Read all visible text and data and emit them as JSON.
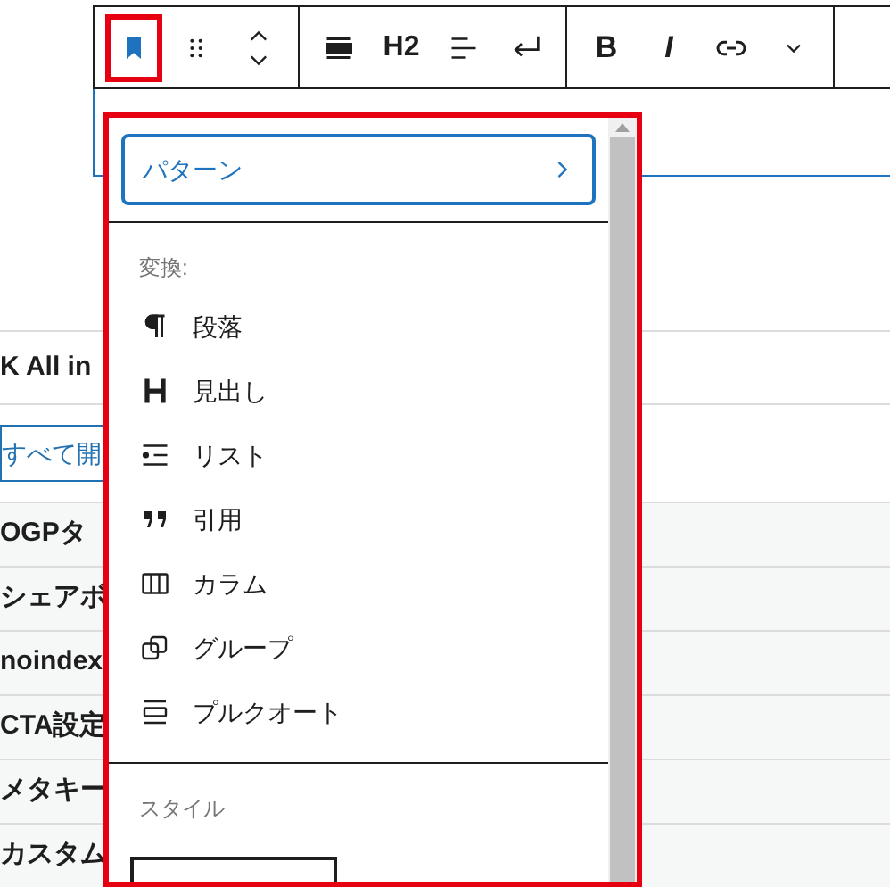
{
  "toolbar": {
    "groups": [
      [
        {
          "kind": "bookmark",
          "highlighted": true
        },
        {
          "kind": "drag"
        },
        {
          "kind": "move"
        }
      ],
      [
        {
          "kind": "align-wide"
        },
        {
          "kind": "text",
          "label": "H2"
        },
        {
          "kind": "align-left"
        },
        {
          "kind": "return"
        }
      ],
      [
        {
          "kind": "bold",
          "label": "B"
        },
        {
          "kind": "italic",
          "label": "I"
        },
        {
          "kind": "link"
        },
        {
          "kind": "more"
        }
      ]
    ]
  },
  "sidebar": {
    "rows": [
      {
        "kind": "heading",
        "text": "K All in"
      },
      {
        "kind": "link",
        "text": "すべて開"
      },
      {
        "kind": "row",
        "text": "OGPタ"
      },
      {
        "kind": "row",
        "text": "シェアボ"
      },
      {
        "kind": "row",
        "text": "noindex"
      },
      {
        "kind": "row",
        "text": "CTA設定"
      },
      {
        "kind": "row",
        "text": "メタキー"
      },
      {
        "kind": "row",
        "text": "カスタム"
      }
    ]
  },
  "popover": {
    "highlighted": true,
    "pattern_button": "パターン",
    "transform_label": "変換:",
    "items": [
      {
        "kind": "paragraph",
        "label": "段落"
      },
      {
        "kind": "heading",
        "label": "見出し"
      },
      {
        "kind": "list",
        "label": "リスト"
      },
      {
        "kind": "quote",
        "label": "引用"
      },
      {
        "kind": "columns",
        "label": "カラム"
      },
      {
        "kind": "group",
        "label": "グループ"
      },
      {
        "kind": "pullquote",
        "label": "プルクオート"
      }
    ],
    "style_label": "スタイル"
  }
}
